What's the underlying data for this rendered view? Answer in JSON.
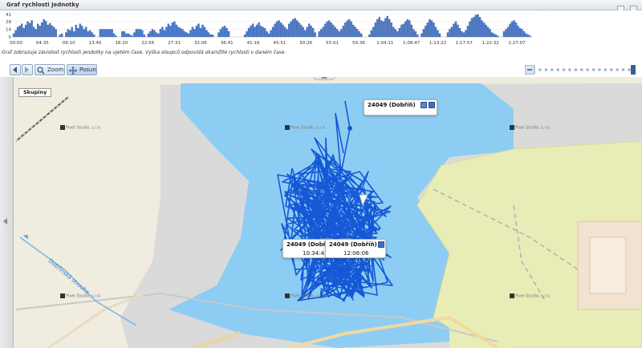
{
  "panel": {
    "title": "Graf rychlosti jednotky"
  },
  "chart_data": {
    "type": "bar",
    "title": "",
    "xlabel": "",
    "ylabel": "",
    "y_ticks": [
      "41",
      "28",
      "14",
      "0"
    ],
    "ylim": [
      0,
      41
    ],
    "x_ticks": [
      "00:00",
      "04:35",
      "09:10",
      "13:45",
      "18:20",
      "22:56",
      "27:31",
      "32:06",
      "36:41",
      "41:16",
      "45:51",
      "50:26",
      "55:01",
      "59:36",
      "1:04:11",
      "1:08:47",
      "1:13:22",
      "1:17:57",
      "1:22:32",
      "1:27:07"
    ],
    "values": [
      6,
      12,
      18,
      20,
      24,
      16,
      22,
      28,
      25,
      30,
      18,
      14,
      24,
      20,
      26,
      32,
      29,
      22,
      25,
      21,
      18,
      14,
      0,
      4,
      6,
      0,
      8,
      14,
      12,
      18,
      10,
      22,
      16,
      24,
      20,
      14,
      18,
      10,
      12,
      8,
      4,
      0,
      0,
      14,
      14,
      14,
      14,
      14,
      14,
      14,
      6,
      2,
      0,
      0,
      10,
      10,
      6,
      6,
      4,
      2,
      8,
      14,
      14,
      14,
      12,
      4,
      0,
      6,
      10,
      14,
      12,
      8,
      6,
      14,
      18,
      12,
      18,
      24,
      20,
      26,
      28,
      22,
      18,
      16,
      14,
      10,
      8,
      6,
      12,
      18,
      14,
      20,
      24,
      16,
      22,
      18,
      12,
      8,
      4,
      4,
      0,
      0,
      8,
      14,
      18,
      20,
      16,
      10,
      0,
      0,
      0,
      0,
      0,
      0,
      0,
      4,
      10,
      16,
      20,
      24,
      18,
      22,
      26,
      20,
      18,
      16,
      10,
      6,
      12,
      18,
      24,
      28,
      30,
      26,
      22,
      18,
      14,
      24,
      28,
      32,
      34,
      30,
      26,
      22,
      18,
      12,
      18,
      24,
      20,
      16,
      8,
      0,
      10,
      14,
      18,
      24,
      28,
      30,
      26,
      22,
      18,
      14,
      10,
      14,
      20,
      26,
      30,
      32,
      28,
      22,
      18,
      14,
      10,
      6,
      0,
      0,
      0,
      4,
      12,
      18,
      26,
      32,
      36,
      30,
      28,
      34,
      38,
      32,
      26,
      18,
      14,
      10,
      16,
      22,
      24,
      28,
      32,
      30,
      22,
      14,
      10,
      4,
      0,
      6,
      14,
      20,
      26,
      32,
      30,
      26,
      18,
      12,
      6,
      0,
      0,
      0,
      8,
      14,
      18,
      24,
      28,
      22,
      16,
      10,
      8,
      12,
      20,
      28,
      34,
      36,
      40,
      41,
      36,
      30,
      26,
      22,
      18,
      14,
      8,
      6,
      4,
      2,
      0,
      0,
      10,
      14,
      18,
      24,
      28,
      30,
      26,
      20,
      16,
      14,
      10,
      6,
      4,
      2
    ]
  },
  "chart_description": "Graf zobrazuje závislost rychlosti jendotky na ujetém čase. Výška sloupců odpovídá okamžité rychlosti v daném čase.",
  "toolbar": {
    "zoom_label": "Zoom",
    "pan_label": "Posun"
  },
  "map": {
    "groups_label": "Skupiny",
    "stream_label": "Dobřínská strouha",
    "copyright_text": "Pixel Studio, s.r.o.",
    "water_color": "#8ecdf3",
    "track_color": "#1558d6"
  },
  "tooltips": [
    {
      "name": "24049 (Dobříň)",
      "time": ""
    },
    {
      "name": "24049 (Dobří",
      "time": "10:34:4"
    },
    {
      "name": "24049 (Dobříň)",
      "time": "12:06:06"
    }
  ]
}
